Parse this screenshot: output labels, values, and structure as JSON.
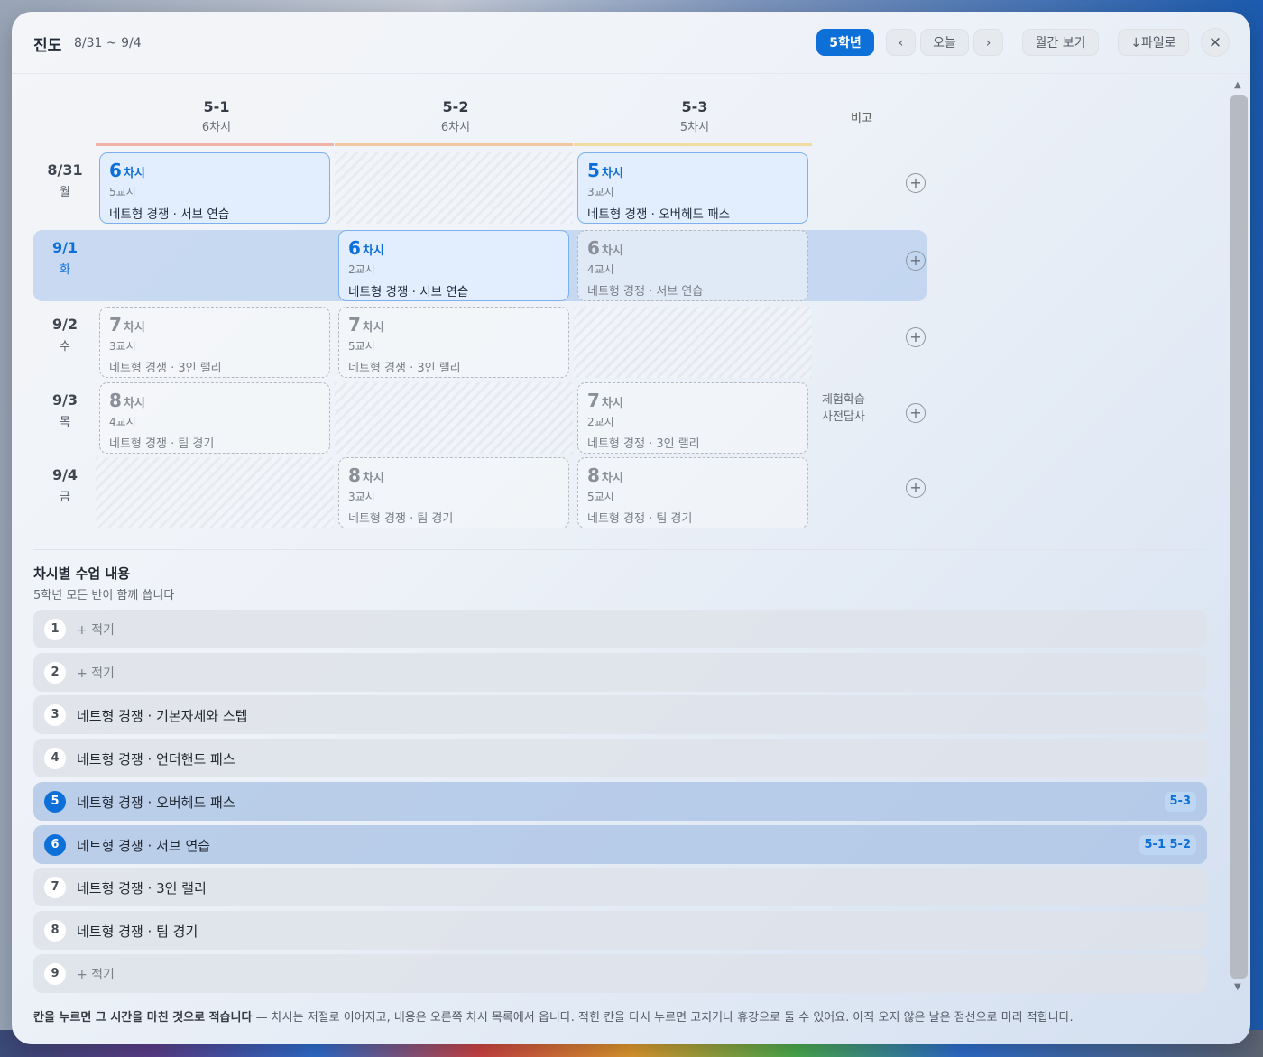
{
  "header": {
    "title": "진도",
    "range": "8/31 ~ 9/4",
    "grade": "5학년",
    "prev": "‹",
    "today": "오늘",
    "next": "›",
    "monthly": "월간 보기",
    "export": "↓파일로",
    "close": "✕"
  },
  "columns": [
    {
      "name": "5-1",
      "count": "6차시",
      "color": "#f0b3a6"
    },
    {
      "name": "5-2",
      "count": "6차시",
      "color": "#f2c7a4"
    },
    {
      "name": "5-3",
      "count": "5차시",
      "color": "#f0dba3"
    }
  ],
  "bigo_label": "비고",
  "rows": [
    {
      "date": "8/31",
      "weekday": "월",
      "today": false,
      "note": "",
      "cells": [
        {
          "type": "solid",
          "num": "6",
          "label": "차시",
          "period": "5교시",
          "topic": "네트형 경쟁 · 서브 연습"
        },
        {
          "type": "hatch"
        },
        {
          "type": "solid",
          "num": "5",
          "label": "차시",
          "period": "3교시",
          "topic": "네트형 경쟁 · 오버헤드 패스"
        }
      ]
    },
    {
      "date": "9/1",
      "weekday": "화",
      "today": true,
      "note": "",
      "cells": [
        {
          "type": "empty"
        },
        {
          "type": "solid",
          "num": "6",
          "label": "차시",
          "period": "2교시",
          "topic": "네트형 경쟁 · 서브 연습"
        },
        {
          "type": "dash",
          "num": "6",
          "label": "차시",
          "period": "4교시",
          "topic": "네트형 경쟁 · 서브 연습"
        }
      ]
    },
    {
      "date": "9/2",
      "weekday": "수",
      "today": false,
      "note": "",
      "cells": [
        {
          "type": "dash",
          "num": "7",
          "label": "차시",
          "period": "3교시",
          "topic": "네트형 경쟁 · 3인 랠리"
        },
        {
          "type": "dash",
          "num": "7",
          "label": "차시",
          "period": "5교시",
          "topic": "네트형 경쟁 · 3인 랠리"
        },
        {
          "type": "hatch"
        }
      ]
    },
    {
      "date": "9/3",
      "weekday": "목",
      "today": false,
      "note": "체험학습\n사전답사",
      "cells": [
        {
          "type": "dash",
          "num": "8",
          "label": "차시",
          "period": "4교시",
          "topic": "네트형 경쟁 · 팀 경기"
        },
        {
          "type": "hatch"
        },
        {
          "type": "dash",
          "num": "7",
          "label": "차시",
          "period": "2교시",
          "topic": "네트형 경쟁 · 3인 랠리"
        }
      ]
    },
    {
      "date": "9/4",
      "weekday": "금",
      "today": false,
      "note": "",
      "cells": [
        {
          "type": "hatch"
        },
        {
          "type": "dash",
          "num": "8",
          "label": "차시",
          "period": "3교시",
          "topic": "네트형 경쟁 · 팀 경기"
        },
        {
          "type": "dash",
          "num": "8",
          "label": "차시",
          "period": "5교시",
          "topic": "네트형 경쟁 · 팀 경기"
        }
      ]
    }
  ],
  "lessons_title": "차시별 수업 내용",
  "lessons_subtitle": "5학년 모든 반이 함께 씁니다",
  "lessons": [
    {
      "n": "1",
      "text": "+ 적기",
      "empty": true,
      "active": false,
      "tag": ""
    },
    {
      "n": "2",
      "text": "+ 적기",
      "empty": true,
      "active": false,
      "tag": ""
    },
    {
      "n": "3",
      "text": "네트형 경쟁 · 기본자세와 스텝",
      "empty": false,
      "active": false,
      "tag": ""
    },
    {
      "n": "4",
      "text": "네트형 경쟁 · 언더핸드 패스",
      "empty": false,
      "active": false,
      "tag": ""
    },
    {
      "n": "5",
      "text": "네트형 경쟁 · 오버헤드 패스",
      "empty": false,
      "active": true,
      "tag": "5-3"
    },
    {
      "n": "6",
      "text": "네트형 경쟁 · 서브 연습",
      "empty": false,
      "active": true,
      "tag": "5-1 5-2"
    },
    {
      "n": "7",
      "text": "네트형 경쟁 · 3인 랠리",
      "empty": false,
      "active": false,
      "tag": ""
    },
    {
      "n": "8",
      "text": "네트형 경쟁 · 팀 경기",
      "empty": false,
      "active": false,
      "tag": ""
    },
    {
      "n": "9",
      "text": "+ 적기",
      "empty": true,
      "active": false,
      "tag": ""
    }
  ],
  "footer": {
    "bold": "칸을 누르면 그 시간을 마친 것으로 적습니다",
    "rest": " — 차시는 저절로 이어지고, 내용은 오른쪽 차시 목록에서 옵니다. 적힌 칸을 다시 누르면 고치거나 휴강으로 둘 수 있어요. 아직 오지 않은 날은 점선으로 미리 적힙니다."
  },
  "icons": {
    "add": "+",
    "scroll_up": "▲",
    "scroll_down": "▼"
  }
}
